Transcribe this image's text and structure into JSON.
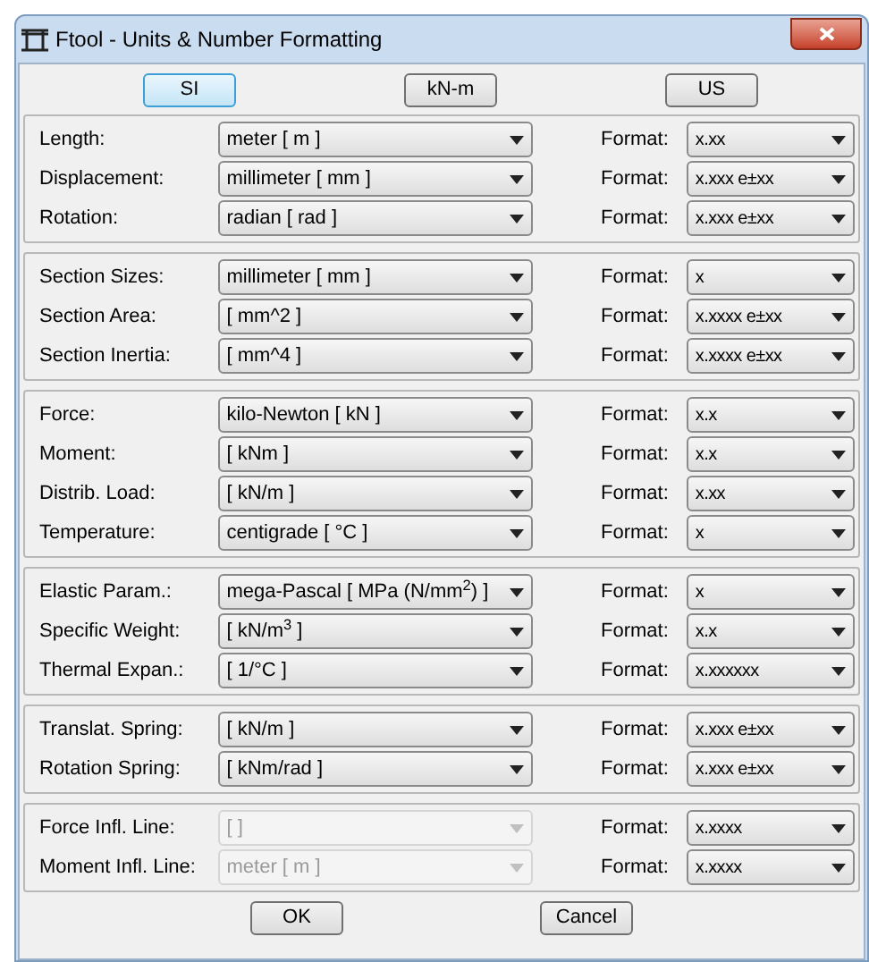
{
  "window": {
    "title": "Ftool - Units & Number Formatting"
  },
  "systems": [
    {
      "label": "SI",
      "selected": true
    },
    {
      "label": "kN-m",
      "selected": false
    },
    {
      "label": "US",
      "selected": false
    }
  ],
  "groups": [
    {
      "rows": [
        {
          "label": "Length:",
          "unit": "meter [ m ]",
          "unit_disabled": false,
          "format_label": "Format:",
          "format": "x.xx"
        },
        {
          "label": "Displacement:",
          "unit": "millimeter [ mm ]",
          "unit_disabled": false,
          "format_label": "Format:",
          "format": "x.xxx e±xx"
        },
        {
          "label": "Rotation:",
          "unit": "radian [ rad ]",
          "unit_disabled": false,
          "format_label": "Format:",
          "format": "x.xxx e±xx"
        }
      ]
    },
    {
      "rows": [
        {
          "label": "Section Sizes:",
          "unit": "millimeter [ mm ]",
          "unit_disabled": false,
          "format_label": "Format:",
          "format": "x"
        },
        {
          "label": "Section Area:",
          "unit": "[ mm^2 ]",
          "unit_disabled": false,
          "format_label": "Format:",
          "format": "x.xxxx e±xx"
        },
        {
          "label": "Section Inertia:",
          "unit": "[ mm^4 ]",
          "unit_disabled": false,
          "format_label": "Format:",
          "format": "x.xxxx e±xx"
        }
      ]
    },
    {
      "rows": [
        {
          "label": "Force:",
          "unit": "kilo-Newton [ kN ]",
          "unit_disabled": false,
          "format_label": "Format:",
          "format": "x.x"
        },
        {
          "label": "Moment:",
          "unit": "[ kNm ]",
          "unit_disabled": false,
          "format_label": "Format:",
          "format": "x.x"
        },
        {
          "label": "Distrib. Load:",
          "unit": "[ kN/m ]",
          "unit_disabled": false,
          "format_label": "Format:",
          "format": "x.xx"
        },
        {
          "label": "Temperature:",
          "unit": "centigrade [ °C ]",
          "unit_disabled": false,
          "format_label": "Format:",
          "format": "x"
        }
      ]
    },
    {
      "rows": [
        {
          "label": "Elastic Param.:",
          "unit": "mega-Pascal [ MPa (N/mm$^{2}$) ]",
          "unit_disabled": false,
          "format_label": "Format:",
          "format": "x"
        },
        {
          "label": "Specific Weight:",
          "unit": "[ kN/m$^{3}$ ]",
          "unit_disabled": false,
          "format_label": "Format:",
          "format": "x.x"
        },
        {
          "label": "Thermal Expan.:",
          "unit": "[ 1/°C ]",
          "unit_disabled": false,
          "format_label": "Format:",
          "format": "x.xxxxxx"
        }
      ]
    },
    {
      "rows": [
        {
          "label": "Translat. Spring:",
          "unit": "[ kN/m ]",
          "unit_disabled": false,
          "format_label": "Format:",
          "format": "x.xxx e±xx"
        },
        {
          "label": "Rotation Spring:",
          "unit": "[ kNm/rad ]",
          "unit_disabled": false,
          "format_label": "Format:",
          "format": "x.xxx e±xx"
        }
      ]
    },
    {
      "rows": [
        {
          "label": "Force Infl. Line:",
          "unit": "[ ]",
          "unit_disabled": true,
          "format_label": "Format:",
          "format": "x.xxxx"
        },
        {
          "label": "Moment Infl. Line:",
          "unit": "meter [ m ]",
          "unit_disabled": true,
          "format_label": "Format:",
          "format": "x.xxxx"
        }
      ]
    }
  ],
  "buttons": [
    "OK",
    "Cancel"
  ]
}
